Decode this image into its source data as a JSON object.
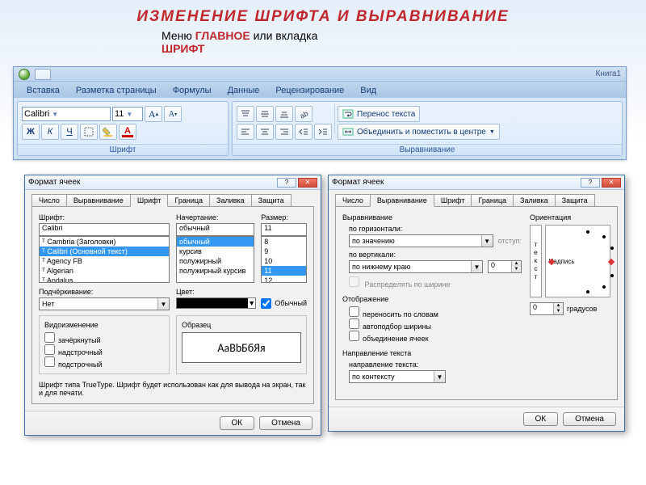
{
  "slide": {
    "title": "ИЗМЕНЕНИЕ   ШРИФТА    И  ВЫРАВНИВАНИЕ",
    "subtitle_pre": "Меню ",
    "subtitle_em1": "ГЛАВНОЕ",
    "subtitle_mid": " или вкладка",
    "subtitle_em2": "ШРИФТ"
  },
  "ribbon": {
    "book": "Книга1",
    "tabs": [
      "Вставка",
      "Разметка страницы",
      "Формулы",
      "Данные",
      "Рецензирование",
      "Вид"
    ],
    "font": {
      "name": "Calibri",
      "size": "11",
      "group_label": "Шрифт",
      "bold": "Ж",
      "italic": "К",
      "underline": "Ч"
    },
    "align": {
      "group_label": "Выравнивание",
      "wrap": "Перенос текста",
      "merge": "Объединить и поместить в центре"
    }
  },
  "dlg1": {
    "title": "Формат ячеек",
    "tabs": [
      "Число",
      "Выравнивание",
      "Шрифт",
      "Граница",
      "Заливка",
      "Защита"
    ],
    "active_tab": 2,
    "font_label": "Шрифт:",
    "font_value": "Calibri",
    "font_list": [
      "Cambria (Заголовки)",
      "Calibri (Основной текст)",
      "Agency FB",
      "Algerian",
      "Andalus"
    ],
    "font_selected_idx": 1,
    "style_label": "Начертание:",
    "style_value": "обычный",
    "style_list": [
      "обычный",
      "курсив",
      "полужирный",
      "полужирный курсив"
    ],
    "style_selected_idx": 0,
    "size_label": "Размер:",
    "size_value": "11",
    "size_list": [
      "8",
      "9",
      "10",
      "11",
      "12"
    ],
    "size_selected_idx": 3,
    "underline_label": "Подчёркивание:",
    "underline_value": "Нет",
    "color_label": "Цвет:",
    "normal_cb": "Обычный",
    "effects_label": "Видоизменение",
    "effects": [
      "зачёркнутый",
      "надстрочный",
      "подстрочный"
    ],
    "sample_label": "Образец",
    "sample_text": "АаВbБбЯя",
    "note": "Шрифт типа TrueType. Шрифт будет использован как для вывода на экран, так и для печати.",
    "ok": "ОК",
    "cancel": "Отмена"
  },
  "dlg2": {
    "title": "Формат ячеек",
    "tabs": [
      "Число",
      "Выравнивание",
      "Шрифт",
      "Граница",
      "Заливка",
      "Защита"
    ],
    "active_tab": 1,
    "group_align": "Выравнивание",
    "h_label": "по горизонтали:",
    "h_value": "по значению",
    "indent_label": "отступ:",
    "indent_value": "0",
    "v_label": "по вертикали:",
    "v_value": "по нижнему краю",
    "distribute": "Распределять по ширине",
    "group_display": "Отображение",
    "display": [
      "переносить по словам",
      "автоподбор ширины",
      "объединение ячеек"
    ],
    "group_dir": "Направление текста",
    "dir_label": "направление текста:",
    "dir_value": "по контексту",
    "orient_label": "Ориентация",
    "orient_text": "т\nе\nк\nс\nт",
    "orient_caption": "Надпись",
    "degrees_value": "0",
    "degrees_label": "градусов",
    "ok": "ОК",
    "cancel": "Отмена"
  }
}
